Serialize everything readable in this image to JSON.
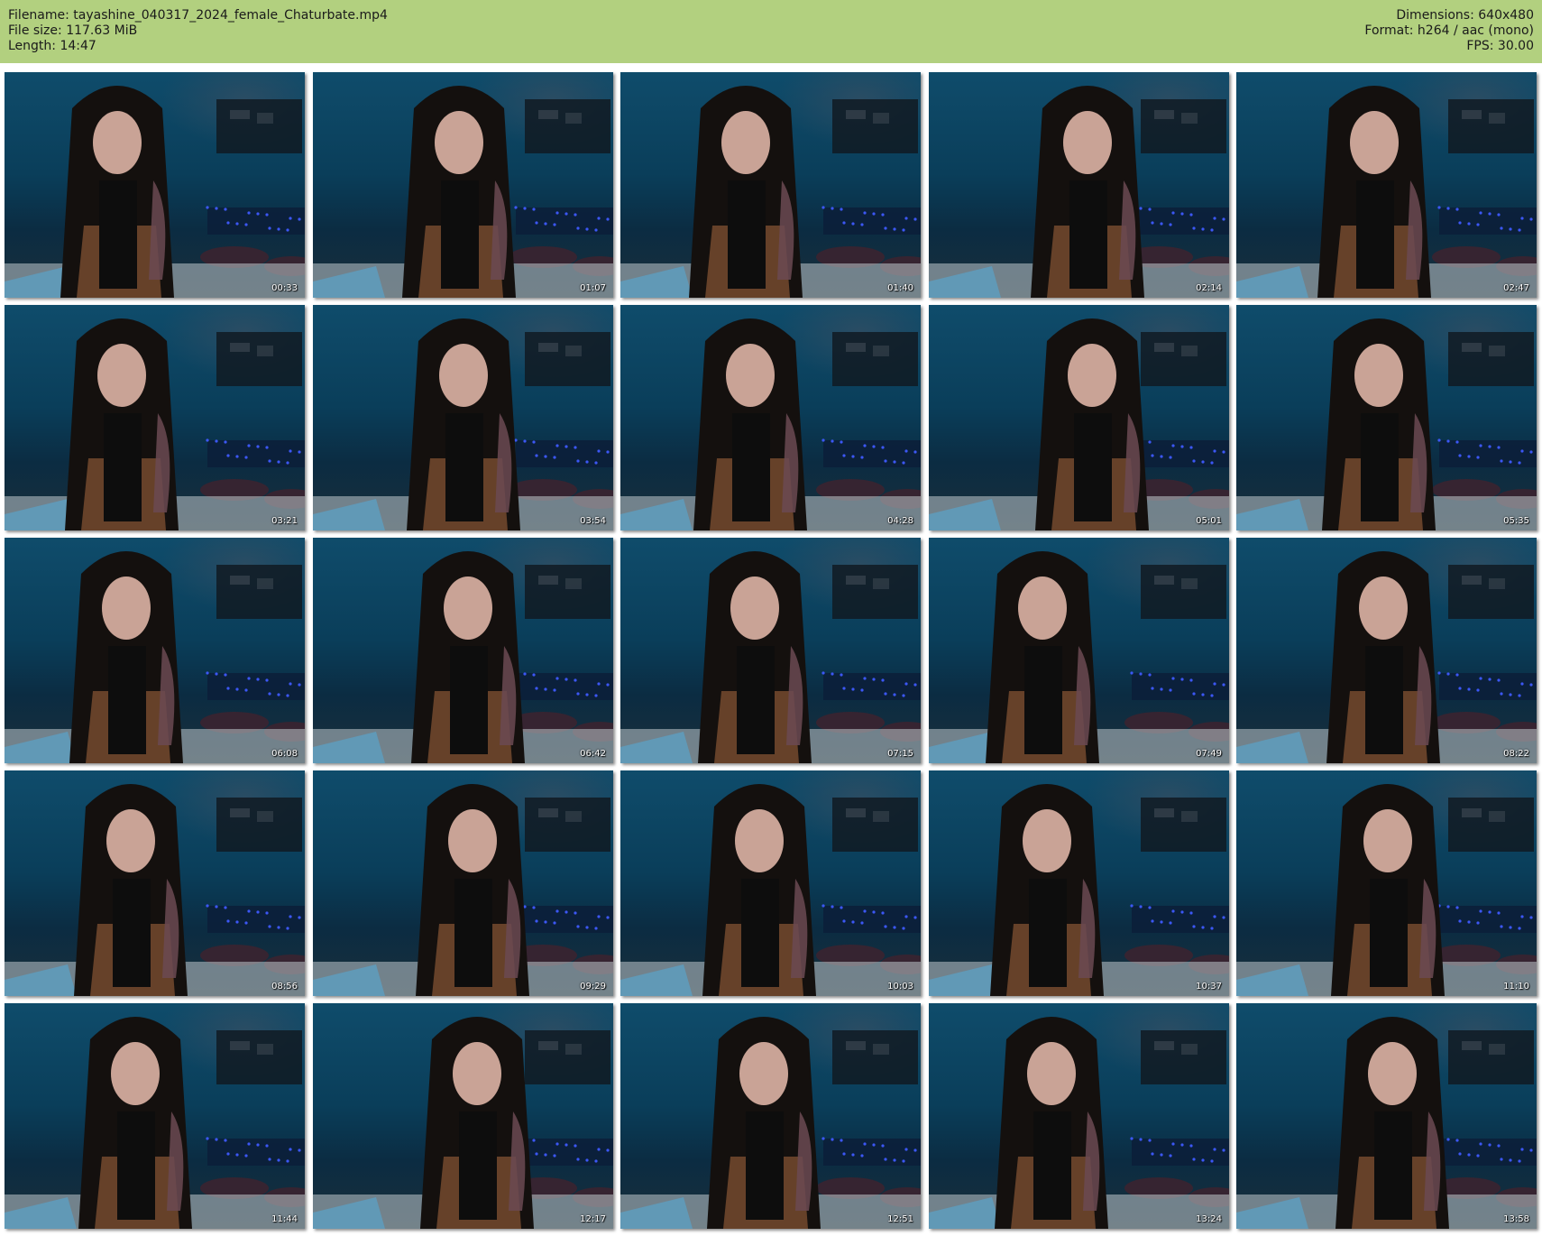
{
  "header": {
    "filename": "Filename: tayashine_040317_2024_female_Chaturbate.mp4",
    "file_size": "File size: 117.63 MiB",
    "length": "Length: 14:47",
    "dimensions": "Dimensions: 640x480",
    "format": "Format: h264 / aac (mono)",
    "fps": "FPS: 30.00"
  },
  "thumbnails": [
    {
      "timestamp": "00:33"
    },
    {
      "timestamp": "01:07"
    },
    {
      "timestamp": "01:40"
    },
    {
      "timestamp": "02:14"
    },
    {
      "timestamp": "02:47"
    },
    {
      "timestamp": "03:21"
    },
    {
      "timestamp": "03:54"
    },
    {
      "timestamp": "04:28"
    },
    {
      "timestamp": "05:01"
    },
    {
      "timestamp": "05:35"
    },
    {
      "timestamp": "06:08"
    },
    {
      "timestamp": "06:42"
    },
    {
      "timestamp": "07:15"
    },
    {
      "timestamp": "07:49"
    },
    {
      "timestamp": "08:22"
    },
    {
      "timestamp": "08:56"
    },
    {
      "timestamp": "09:29"
    },
    {
      "timestamp": "10:03"
    },
    {
      "timestamp": "10:37"
    },
    {
      "timestamp": "11:10"
    },
    {
      "timestamp": "11:44"
    },
    {
      "timestamp": "12:17"
    },
    {
      "timestamp": "12:51"
    },
    {
      "timestamp": "13:24"
    },
    {
      "timestamp": "13:58"
    }
  ],
  "colors": {
    "header_bg": "#b2d07f",
    "wall_blue": "#0f4c6b",
    "hair_dark": "#14100e",
    "hair_tip": "#a9693f",
    "skin": "#c9a396",
    "lights": "#3f5bff"
  }
}
